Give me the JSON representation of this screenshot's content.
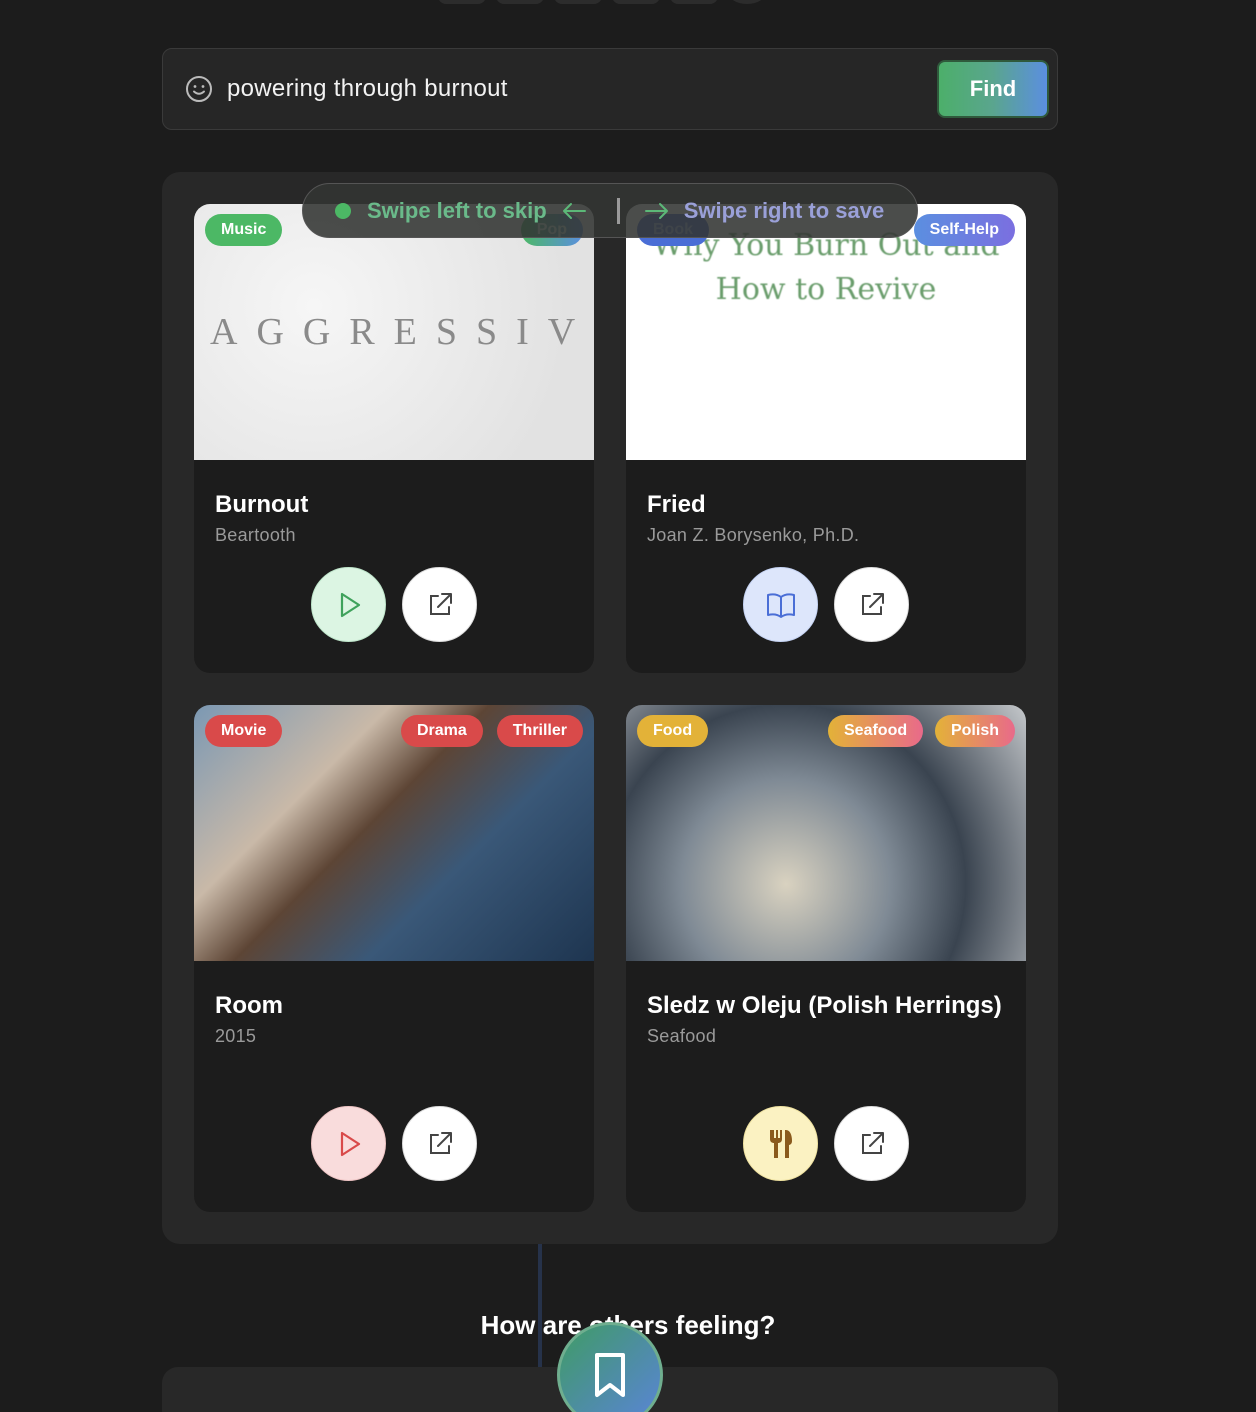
{
  "search": {
    "value": "powering through burnout",
    "find_label": "Find"
  },
  "swipe_hint": {
    "skip": "Swipe left to skip",
    "save": "Swipe right to save"
  },
  "cards": [
    {
      "type_tag": "Music",
      "genre_tags": [
        "Pop"
      ],
      "cover_text": "AGGRESSIVE",
      "title": "Burnout",
      "subtitle": "Beartooth",
      "primary_action_icon": "play-icon"
    },
    {
      "type_tag": "Book",
      "genre_tags": [
        "Self-Help"
      ],
      "cover_text": "Why You Burn Out and How to Revive",
      "title": "Fried",
      "subtitle": "Joan Z. Borysenko, Ph.D.",
      "primary_action_icon": "book-open-icon"
    },
    {
      "type_tag": "Movie",
      "genre_tags": [
        "Drama",
        "Thriller"
      ],
      "title": "Room",
      "subtitle": "2015",
      "primary_action_icon": "play-icon"
    },
    {
      "type_tag": "Food",
      "genre_tags": [
        "Seafood",
        "Polish"
      ],
      "title": "Sledz w Oleju (Polish Herrings)",
      "subtitle": "Seafood",
      "primary_action_icon": "utensils-icon"
    }
  ],
  "section": {
    "others_title": "How are others feeling?"
  },
  "colors": {
    "music": "#4cb865",
    "book": "#5b7fe0",
    "movie": "#d94a4a",
    "food": "#e3b238",
    "accent_green": "#4caf6a",
    "accent_blue": "#5b8fe0"
  }
}
